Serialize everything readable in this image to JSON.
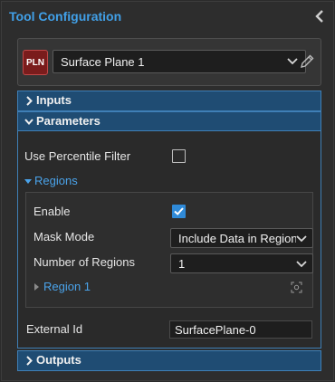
{
  "header": {
    "title": "Tool Configuration"
  },
  "tool": {
    "badge": "PLN",
    "name": "Surface Plane 1"
  },
  "sections": {
    "inputs": {
      "label": "Inputs"
    },
    "parameters": {
      "label": "Parameters"
    },
    "outputs": {
      "label": "Outputs"
    }
  },
  "parameters": {
    "use_percentile_filter": {
      "label": "Use Percentile Filter",
      "checked": false
    },
    "regions": {
      "label": "Regions",
      "enable": {
        "label": "Enable",
        "checked": true
      },
      "mask_mode": {
        "label": "Mask Mode",
        "value": "Include Data in Region"
      },
      "number_of_regions": {
        "label": "Number of Regions",
        "value": "1"
      },
      "region_1": {
        "label": "Region 1"
      }
    },
    "external_id": {
      "label": "External Id",
      "value": "SurfacePlane-0"
    }
  },
  "colors": {
    "accent": "#41a0e8",
    "section_header": "#1f4c73",
    "checkbox_checked": "#2f8ad8",
    "badge": "#7a1c1c"
  },
  "icons": [
    "chevron-left-icon",
    "chevron-down-icon",
    "pencil-icon",
    "chevron-right-icon",
    "triangle-right-icon",
    "triangle-down-icon",
    "crosshair-icon",
    "checkmark-icon"
  ]
}
